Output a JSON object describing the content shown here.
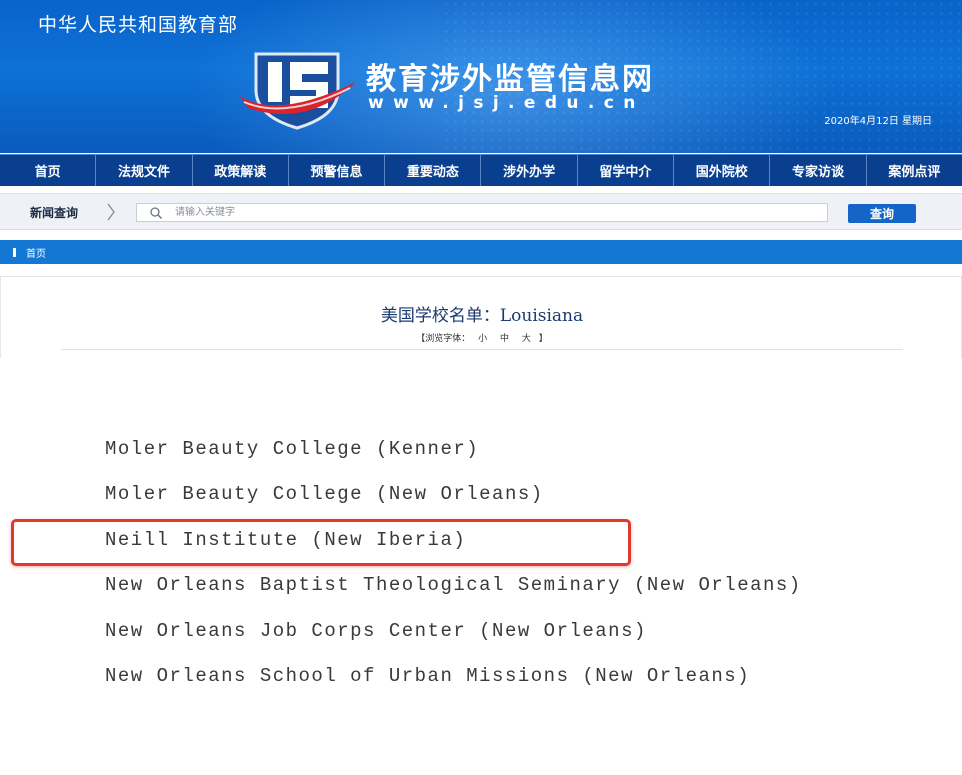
{
  "header": {
    "ministry": "中华人民共和国教育部",
    "site_name": "教育涉外监管信息网",
    "site_url": "www.jsj.edu.cn",
    "date": "2020年4月12日  星期日"
  },
  "nav": {
    "items": [
      "首页",
      "法规文件",
      "政策解读",
      "预警信息",
      "重要动态",
      "涉外办学",
      "留学中介",
      "国外院校",
      "专家访谈",
      "案例点评"
    ]
  },
  "search": {
    "label": "新闻查询",
    "placeholder": "请输入关键字",
    "button_label": "查询"
  },
  "breadcrumb": {
    "home": "首页"
  },
  "article": {
    "title": "美国学校名单：Louisiana",
    "font_bar_prefix": "【浏览字体：",
    "font_small": "小",
    "font_medium": "中",
    "font_large": "大",
    "font_bar_suffix": "】"
  },
  "schools": [
    "Moler Beauty College (Kenner)",
    "Moler Beauty College (New Orleans)",
    "Neill Institute (New Iberia)",
    "New Orleans Baptist Theological Seminary (New Orleans)",
    "New Orleans Job Corps Center (New Orleans)",
    "New Orleans School of Urban Missions (New Orleans)"
  ],
  "colors": {
    "banner_blue": "#0d71d6",
    "nav_blue": "#0a3f8f",
    "breadcrumb_blue": "#1477d4",
    "highlight_red": "#e03a2f"
  }
}
